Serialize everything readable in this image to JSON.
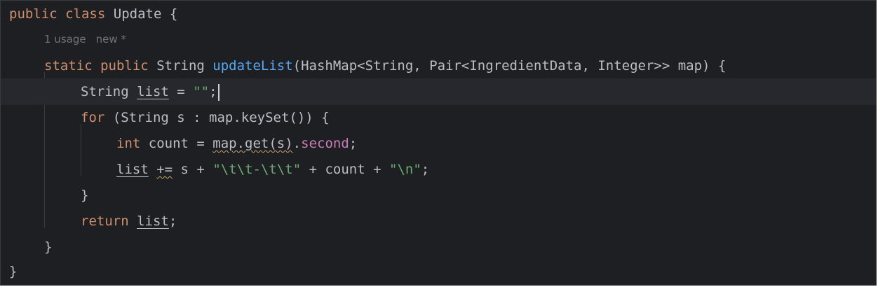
{
  "editor": {
    "inlay_hint": {
      "usage": "1 usage",
      "author": "new *"
    },
    "lines": {
      "l1": {
        "kw1": "public",
        "kw2": "class",
        "rest": "Update {"
      },
      "l3": {
        "kw1": "static",
        "kw2": "public",
        "type": "String",
        "method": "updateList",
        "params": "(HashMap<String, Pair<IngredientData, Integer>> map) {"
      },
      "l4": {
        "type": "String",
        "var": "list",
        "eq": " = ",
        "str": "\"\"",
        "semi": ";"
      },
      "l5": {
        "kw": "for",
        "rest": " (String s : map.keySet()) {"
      },
      "l6": {
        "kw": "int",
        "mid": " count = ",
        "call": "map.get(s)",
        "dot": ".",
        "field": "second",
        "semi": ";"
      },
      "l7": {
        "var": "list",
        "sp": " ",
        "op": "+=",
        "mid": " s + ",
        "str1": "\"\\t\\t-\\t\\t\"",
        "mid2": " + count + ",
        "str2": "\"\\n\"",
        "semi": ";"
      },
      "l8": {
        "text": "}"
      },
      "l9": {
        "kw": "return",
        "sp": " ",
        "var": "list",
        "semi": ";"
      },
      "l10": {
        "text": "}"
      },
      "l11": {
        "text": "}"
      }
    }
  }
}
